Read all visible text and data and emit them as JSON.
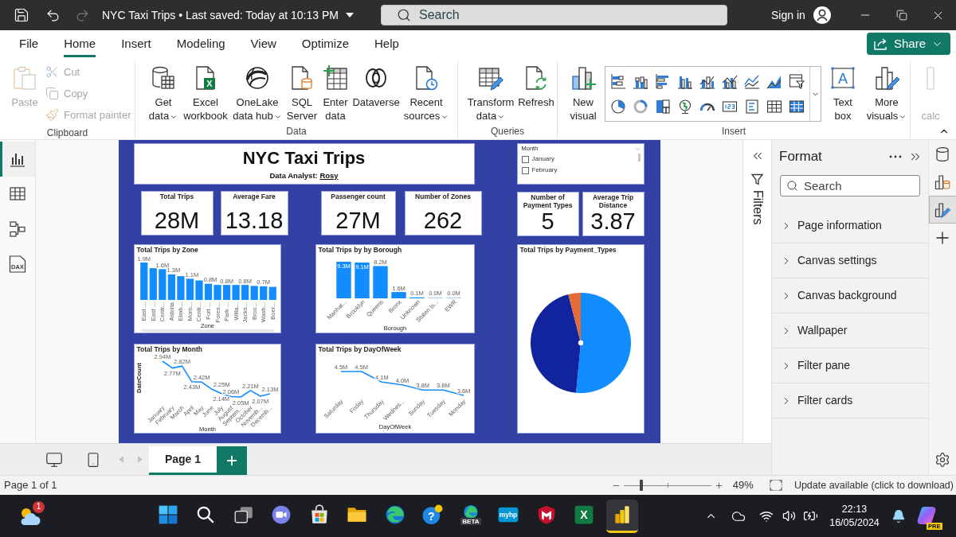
{
  "title_bar": {
    "document_title": "NYC Taxi Trips • Last saved: Today at 10:13 PM",
    "search": {
      "placeholder": "Search"
    },
    "sign_in": "Sign in"
  },
  "menu_tabs": [
    {
      "label": "File",
      "selected": false
    },
    {
      "label": "Home",
      "selected": true
    },
    {
      "label": "Insert",
      "selected": false
    },
    {
      "label": "Modeling",
      "selected": false
    },
    {
      "label": "View",
      "selected": false
    },
    {
      "label": "Optimize",
      "selected": false
    },
    {
      "label": "Help",
      "selected": false
    }
  ],
  "share_button": {
    "label": "Share"
  },
  "ribbon": [
    {
      "group": "Clipboard",
      "buttons": [
        {
          "kind": "large",
          "label": "Paste",
          "disabled": true,
          "dropdown": false
        },
        {
          "kind": "small",
          "label": "Cut",
          "disabled": true,
          "dropdown": false
        },
        {
          "kind": "small",
          "label": "Copy",
          "disabled": true,
          "dropdown": false
        },
        {
          "kind": "small",
          "label": "Format painter",
          "disabled": true,
          "dropdown": false
        }
      ]
    },
    {
      "group": "Data",
      "buttons": [
        {
          "kind": "large",
          "label": "Get data",
          "disabled": false,
          "dropdown": true
        },
        {
          "kind": "large",
          "label": "Excel workbook",
          "disabled": false,
          "dropdown": false,
          "icon_text": "X"
        },
        {
          "kind": "large",
          "label": "OneLake data hub",
          "disabled": false,
          "dropdown": true
        },
        {
          "kind": "large",
          "label": "SQL Server",
          "disabled": false,
          "dropdown": false
        },
        {
          "kind": "large",
          "label": "Enter data",
          "disabled": false,
          "dropdown": false
        },
        {
          "kind": "large",
          "label": "Dataverse",
          "disabled": false,
          "dropdown": false
        },
        {
          "kind": "large",
          "label": "Recent sources",
          "disabled": false,
          "dropdown": true
        }
      ]
    },
    {
      "group": "Queries",
      "buttons": [
        {
          "kind": "large",
          "label": "Transform data",
          "disabled": false,
          "dropdown": true
        },
        {
          "kind": "large",
          "label": "Refresh",
          "disabled": false,
          "dropdown": false
        }
      ]
    },
    {
      "group": "Insert",
      "buttons": [
        {
          "kind": "large",
          "label": "New visual",
          "disabled": false,
          "dropdown": false
        },
        {
          "kind": "gallery",
          "disabled": false,
          "dropdown": true
        },
        {
          "kind": "large",
          "label": "Text box",
          "disabled": false,
          "dropdown": false,
          "icon_text": "A"
        },
        {
          "kind": "large",
          "label": "More visuals",
          "disabled": false,
          "dropdown": true
        }
      ]
    },
    {
      "buttons": [
        {
          "kind": "large",
          "label": "calc",
          "disabled": true,
          "dropdown": false
        }
      ]
    }
  ],
  "view_rail": [
    {
      "selected": true
    },
    {
      "selected": false
    },
    {
      "selected": false
    },
    {
      "selected": false,
      "icon_text": "DAX"
    }
  ],
  "report": {
    "title": "NYC Taxi Trips",
    "analyst_label": "Data Analyst:",
    "analyst_name": "Rosy",
    "month_slicer": {
      "title": "Month",
      "options": [
        {
          "label": "January",
          "checked": false
        },
        {
          "label": "February",
          "checked": false
        }
      ]
    },
    "kpi_cards": [
      {
        "label": "Total Trips",
        "value": "28M"
      },
      {
        "label": "Average Fare",
        "value": "13.18"
      },
      {
        "label": "Passenger count",
        "value": "27M"
      },
      {
        "label": "Number of Zones",
        "value": "262"
      }
    ],
    "side_cards": [
      {
        "label": "Number of Payment Types",
        "value": "5"
      },
      {
        "label": "Average Trip Distance",
        "value": "3.87"
      }
    ],
    "zone_chart": {
      "chart_data": {
        "type": "bar",
        "title": "Total Trips by Zone",
        "xlabel": "Zone",
        "categories": [
          "East ...",
          "East ...",
          "Centr...",
          "Astoria",
          "Elmh...",
          "Morn...",
          "Centr...",
          "Fort ...",
          "Fores...",
          "Park ...",
          "Willa...",
          "Jacks...",
          "Broo...",
          "Wash...",
          "Boer..."
        ],
        "values": [
          1.92,
          1.63,
          1.58,
          1.31,
          1.22,
          1.09,
          1.0,
          0.83,
          0.77,
          0.77,
          0.77,
          0.77,
          0.72,
          0.7,
          0.67
        ],
        "value_labels": [
          "1.9M",
          null,
          "1.6M",
          "1.3M",
          null,
          "1.1M",
          null,
          "0.8M",
          null,
          "0.8M",
          null,
          "0.8M",
          null,
          "0.7M",
          null
        ]
      }
    },
    "borough_chart": {
      "chart_data": {
        "type": "bar",
        "title": "Total Trips by by Borough",
        "xlabel": "Borough",
        "categories": [
          "Manhat...",
          "Brooklyn",
          "Queens",
          "Bronx",
          "Unknown",
          "Staten Is...",
          "EWR"
        ],
        "values": [
          9.3,
          9.1,
          8.2,
          1.6,
          0.1,
          0.0,
          0.0
        ],
        "value_labels": [
          "9.3M",
          "9.1M",
          "8.2M",
          "1.6M",
          "0.1M",
          "0.0M",
          "0.0M"
        ]
      }
    },
    "payment_chart": {
      "title": "Total Trips by Payment_Types"
    },
    "month_chart": {
      "chart_data": {
        "type": "line",
        "title": "Total Trips by Month",
        "xlabel": "Month",
        "ylabel": "DateCount",
        "categories": [
          "January",
          "February",
          "March",
          "April",
          "May",
          "June",
          "July",
          "August",
          "Septem...",
          "October",
          "Novemb...",
          "Decemb..."
        ],
        "values": [
          2.94,
          2.77,
          2.82,
          2.43,
          2.42,
          2.25,
          2.14,
          2.06,
          2.05,
          2.21,
          2.07,
          2.13
        ],
        "value_labels": [
          "2.94M",
          "2.77M",
          "2.82M",
          "2.43M",
          "2.42M",
          "2.25M",
          "2.14M",
          "2.06M",
          "2.05M",
          "2.21M",
          "2.07M",
          "2.13M"
        ]
      }
    },
    "weekday_chart": {
      "chart_data": {
        "type": "line",
        "title": "Total Trips by DayOfWeek",
        "xlabel": "DayOfWeek",
        "categories": [
          "Saturday",
          "Friday",
          "Thursday",
          "Wednes...",
          "Sunday",
          "Tuesday",
          "Monday"
        ],
        "values": [
          4.5,
          4.5,
          4.1,
          4.0,
          3.8,
          3.8,
          3.6
        ],
        "value_labels": [
          "4.5M",
          "4.5M",
          "4.1M",
          "4.0M",
          "3.8M",
          "3.8M",
          "3.6M"
        ]
      }
    }
  },
  "filters_pane": {
    "label": "Filters"
  },
  "format_pane": {
    "title": "Format",
    "search": {
      "placeholder": "Search"
    },
    "sections": [
      {
        "label": "Page information",
        "expanded": false
      },
      {
        "label": "Canvas settings",
        "expanded": false
      },
      {
        "label": "Canvas background",
        "expanded": false
      },
      {
        "label": "Wallpaper",
        "expanded": false
      },
      {
        "label": "Filter pane",
        "expanded": false
      },
      {
        "label": "Filter cards",
        "expanded": false
      }
    ]
  },
  "pane_rail": [
    {
      "selected": false
    },
    {
      "selected": false
    },
    {
      "selected": true
    },
    {
      "selected": false
    }
  ],
  "page_tabs": [
    {
      "label": "Page 1",
      "selected": true
    }
  ],
  "status_bar": {
    "page_info": "Page 1 of 1",
    "zoom": {
      "level": 0.2,
      "reading": "49%"
    },
    "update_notice": "Update available (click to download)"
  },
  "taskbar": {
    "weather_badge": "1",
    "apps": [
      {
        "active": false
      },
      {
        "active": false
      },
      {
        "active": false
      },
      {
        "active": false
      },
      {
        "active": false
      },
      {
        "active": false
      },
      {
        "active": false
      },
      {
        "active": false,
        "icon_text": "?"
      },
      {
        "active": false,
        "icon_text": "BETA"
      },
      {
        "active": false,
        "icon_text": "myhp"
      },
      {
        "active": false
      },
      {
        "active": false,
        "icon_text": "X"
      },
      {
        "active": true
      }
    ],
    "time": "22:13",
    "date": "16/05/2024",
    "copilot_badge": "PRE"
  }
}
